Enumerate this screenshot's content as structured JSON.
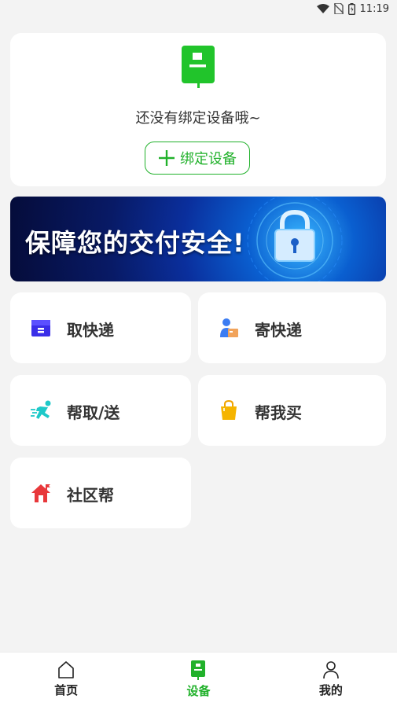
{
  "status_bar": {
    "time": "11:19"
  },
  "device_card": {
    "empty_text": "还没有绑定设备哦~",
    "bind_button_label": "绑定设备"
  },
  "banner": {
    "text": "保障您的交付安全!"
  },
  "services": [
    {
      "label": "取快递",
      "icon": "package-icon"
    },
    {
      "label": "寄快递",
      "icon": "courier-icon"
    },
    {
      "label": "帮取/送",
      "icon": "runner-icon"
    },
    {
      "label": "帮我买",
      "icon": "shopping-bag-icon"
    },
    {
      "label": "社区帮",
      "icon": "house-icon"
    }
  ],
  "bottom_nav": [
    {
      "label": "首页",
      "icon": "home-icon"
    },
    {
      "label": "设备",
      "icon": "device-icon",
      "active": true
    },
    {
      "label": "我的",
      "icon": "user-icon"
    }
  ],
  "colors": {
    "accent": "#21b12b",
    "background": "#f3f3f3"
  }
}
